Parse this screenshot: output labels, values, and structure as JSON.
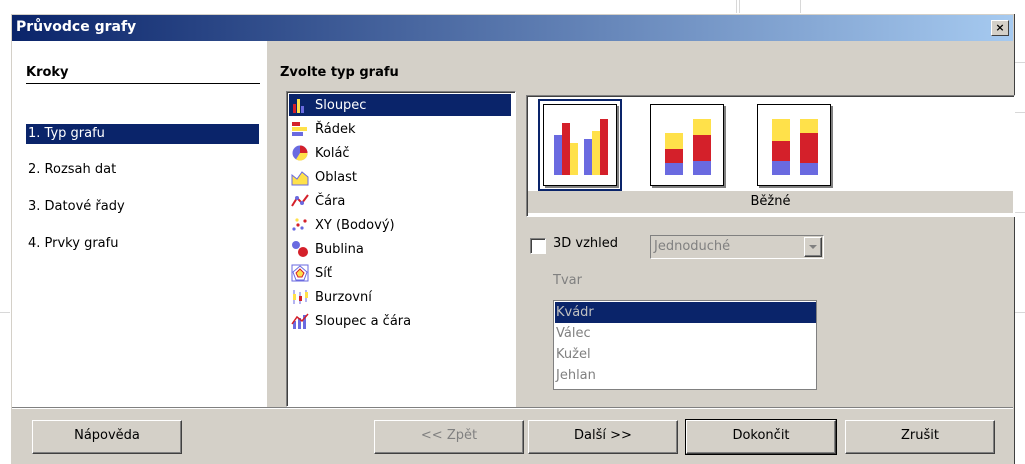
{
  "window": {
    "title": "Průvodce grafy",
    "close_symbol": "×"
  },
  "steps": {
    "title": "Kroky",
    "items": [
      {
        "label": "1. Typ grafu",
        "active": true
      },
      {
        "label": "2. Rozsah dat"
      },
      {
        "label": "3. Datové řady"
      },
      {
        "label": "4. Prvky grafu"
      }
    ]
  },
  "chart_type": {
    "title": "Zvolte typ grafu",
    "items": [
      {
        "label": "Sloupec",
        "icon": "column-chart-icon",
        "active": true
      },
      {
        "label": "Řádek",
        "icon": "bar-chart-icon"
      },
      {
        "label": "Koláč",
        "icon": "pie-chart-icon"
      },
      {
        "label": "Oblast",
        "icon": "area-chart-icon"
      },
      {
        "label": "Čára",
        "icon": "line-chart-icon"
      },
      {
        "label": "XY (Bodový)",
        "icon": "scatter-chart-icon"
      },
      {
        "label": "Bublina",
        "icon": "bubble-chart-icon"
      },
      {
        "label": "Síť",
        "icon": "net-chart-icon"
      },
      {
        "label": "Burzovní",
        "icon": "stock-chart-icon"
      },
      {
        "label": "Sloupec a čára",
        "icon": "column-line-chart-icon"
      }
    ]
  },
  "subtypes": {
    "label": "Běžné",
    "selected_index": 0
  },
  "options": {
    "three_d_label": "3D vzhled",
    "three_d_checked": false,
    "three_d_combo_value": "Jednoduché",
    "shape_label": "Tvar",
    "shapes": [
      "Kvádr",
      "Válec",
      "Kužel",
      "Jehlan"
    ],
    "shape_selected": "Kvádr"
  },
  "buttons": {
    "help": "Nápověda",
    "back": "<< Zpět",
    "next": "Další >>",
    "finish": "Dokončit",
    "cancel": "Zrušit"
  },
  "colors": {
    "selection": "#0a246a",
    "dialog_bg": "#d4d0c8",
    "bar_red": "#d4202a",
    "bar_blue": "#6a6ae0",
    "bar_yellow": "#ffe14a"
  }
}
